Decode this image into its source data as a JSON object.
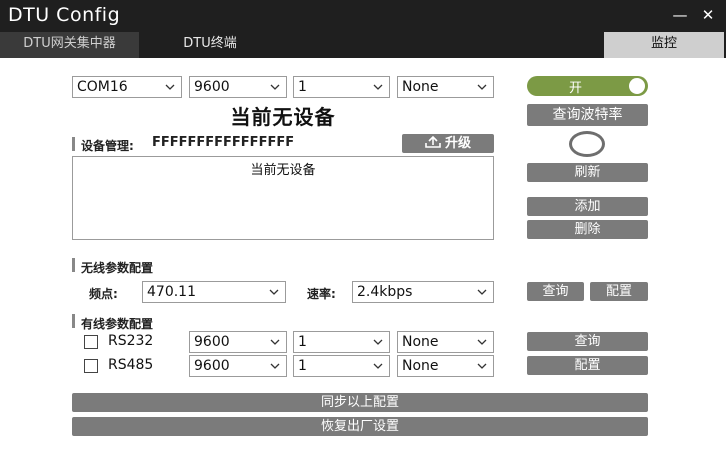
{
  "window": {
    "title": "DTU Config",
    "minimize_glyph": "—",
    "close_glyph": "✕"
  },
  "tabs": {
    "left": "DTU网关集中器",
    "middle": "DTU终端",
    "right": "监控"
  },
  "top_selectors": {
    "port": "COM16",
    "baud": "9600",
    "data_bits": "1",
    "parity": "None"
  },
  "toggle": {
    "label": "开",
    "state": "on",
    "color": "#7c9a45"
  },
  "buttons": {
    "query_baud": "查询波特率",
    "refresh": "刷新",
    "add": "添加",
    "delete": "删除",
    "upgrade": "升级",
    "wireless_query": "查询",
    "wireless_config": "配置",
    "wired_query": "查询",
    "wired_config": "配置",
    "sync_config": "同步以上配置",
    "factory_reset": "恢复出厂设置"
  },
  "status": {
    "headline": "当前无设备",
    "list_text": "当前无设备"
  },
  "device_management": {
    "label": "设备管理:",
    "id": "FFFFFFFFFFFFFFFF"
  },
  "wireless": {
    "section_title": "无线参数配置",
    "freq_label": "频点:",
    "freq_value": "470.11",
    "rate_label": "速率:",
    "rate_value": "2.4kbps"
  },
  "wired": {
    "section_title": "有线参数配置",
    "rows": [
      {
        "name": "RS232",
        "baud": "9600",
        "bits": "1",
        "parity": "None"
      },
      {
        "name": "RS485",
        "baud": "9600",
        "bits": "1",
        "parity": "None"
      }
    ]
  }
}
